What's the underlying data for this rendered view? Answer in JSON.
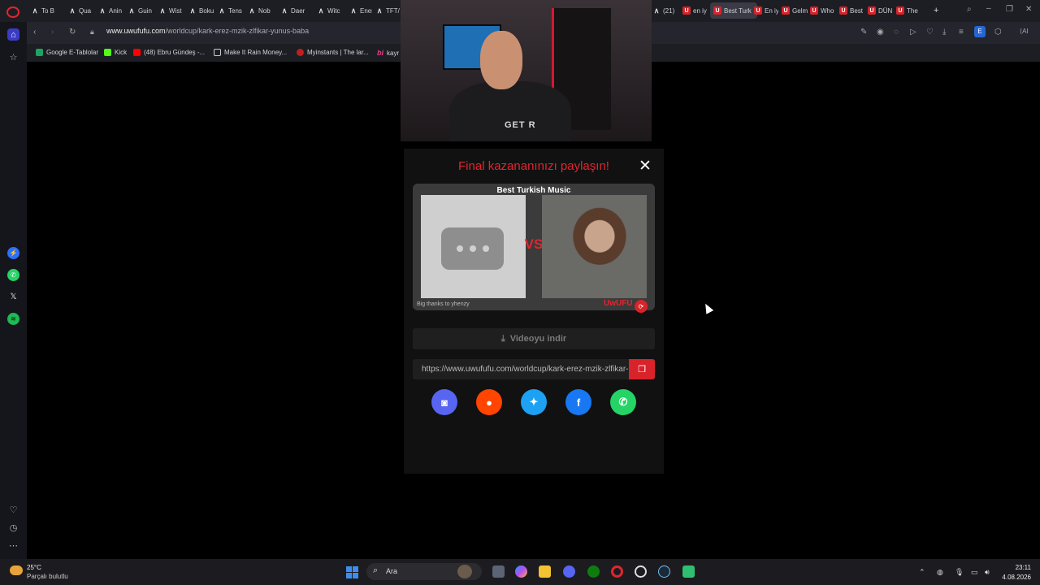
{
  "tabs": [
    {
      "label": "To B",
      "fav": "k"
    },
    {
      "label": "Qua",
      "fav": "k"
    },
    {
      "label": "Anin",
      "fav": "k"
    },
    {
      "label": "Guin",
      "fav": "k"
    },
    {
      "label": "Wist",
      "fav": "k"
    },
    {
      "label": "Boku",
      "fav": "k"
    },
    {
      "label": "Tens",
      "fav": "k"
    },
    {
      "label": "Nob",
      "fav": "k"
    },
    {
      "label": "Daer",
      "fav": "k"
    },
    {
      "label": "Witc",
      "fav": "k"
    },
    {
      "label": "Ener",
      "fav": "k"
    },
    {
      "label": "TFT/",
      "fav": "k"
    },
    {
      "label": "(21)",
      "fav": "k"
    },
    {
      "label": "en iy",
      "fav": "u"
    },
    {
      "label": "Best Turk",
      "fav": "u"
    },
    {
      "label": "En iy",
      "fav": "u"
    },
    {
      "label": "Gelm",
      "fav": "u"
    },
    {
      "label": "Who",
      "fav": "u"
    },
    {
      "label": "Best",
      "fav": "u"
    },
    {
      "label": "DÜN",
      "fav": "u"
    },
    {
      "label": "The",
      "fav": "u"
    }
  ],
  "address": {
    "domain": "www.uwufufu.com",
    "path": "/worldcup/kark-erez-mzik-zlfikar-yunus-baba"
  },
  "bookmarks": [
    "Google E-Tablolar",
    "Kick",
    "(48) Ebru Gündeş -...",
    "Make It Rain Money...",
    "Myinstants | The lar...",
    "kayr"
  ],
  "webcam": {
    "shirt_text": "GET R"
  },
  "modal": {
    "title": "Final kazananınızı paylaşın!",
    "close": "✕",
    "card_title": "Best Turkish Music",
    "vs": "VS",
    "thanks": "Big thanks to yhenzy",
    "watermark": "UwUFU",
    "download_label": "Videoyu indir",
    "share_url": "https://www.uwufufu.com/worldcup/kark-erez-mzik-zlfikar-yunus-baba",
    "share_buttons": [
      {
        "name": "discord",
        "glyph": "◙",
        "color": "#5865f2"
      },
      {
        "name": "reddit",
        "glyph": "●",
        "color": "#ff4500"
      },
      {
        "name": "twitter",
        "glyph": "✦",
        "color": "#1da1f2"
      },
      {
        "name": "facebook",
        "glyph": "f",
        "color": "#1877f2"
      },
      {
        "name": "whatsapp",
        "glyph": "✆",
        "color": "#25d366"
      }
    ]
  },
  "taskbar": {
    "temperature": "25°C",
    "weather": "Parçalı bulutlu",
    "search_placeholder": "Ara",
    "time": "23:11",
    "date": "4.08.2026"
  },
  "colors": {
    "accent": "#e0262f",
    "modal_bg": "#111111"
  }
}
